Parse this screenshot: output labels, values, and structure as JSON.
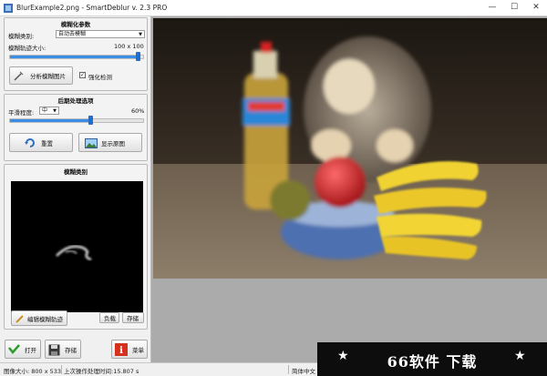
{
  "window": {
    "title": "BlurExample2.png - SmartDeblur v. 2.3 PRO",
    "minimize": "—",
    "maximize": "☐",
    "close": "✕"
  },
  "blur_params": {
    "title": "模糊化参数",
    "type_label": "模糊类别:",
    "type_value": "自动去模糊",
    "kernel_size_label": "模糊轨迹大小:",
    "kernel_size_value": "100 x 100",
    "kernel_size_fraction": 0.96,
    "analyze_button": "分析模糊图片",
    "strengthen_label": "强化检测",
    "strengthen_checked": true
  },
  "post_processing": {
    "title": "后期处理选项",
    "smoothing_label": "平滑程度:",
    "smoothing_value": "中",
    "smoothing_percent": "60%",
    "smoothing_fraction": 0.6,
    "reset_button": "重置",
    "show_original_button": "显示原图"
  },
  "blur_kernel": {
    "title": "模糊类别",
    "edit_button": "编辑模糊轨迹",
    "load_button": "负载",
    "save_button": "存储"
  },
  "bottom_buttons": {
    "open": "打开",
    "save": "存储",
    "menu": "菜单"
  },
  "status": {
    "image_size": "图像大小: 800 x 533",
    "last_time": "上次操作处理时间:15.807 s",
    "language": "简体中文"
  },
  "watermark": {
    "text": "66软件 下载",
    "star": "★"
  },
  "colors": {
    "accent": "#3a8ee6",
    "kernel_bg": "#000000",
    "viewer_bg": "#ababab"
  }
}
